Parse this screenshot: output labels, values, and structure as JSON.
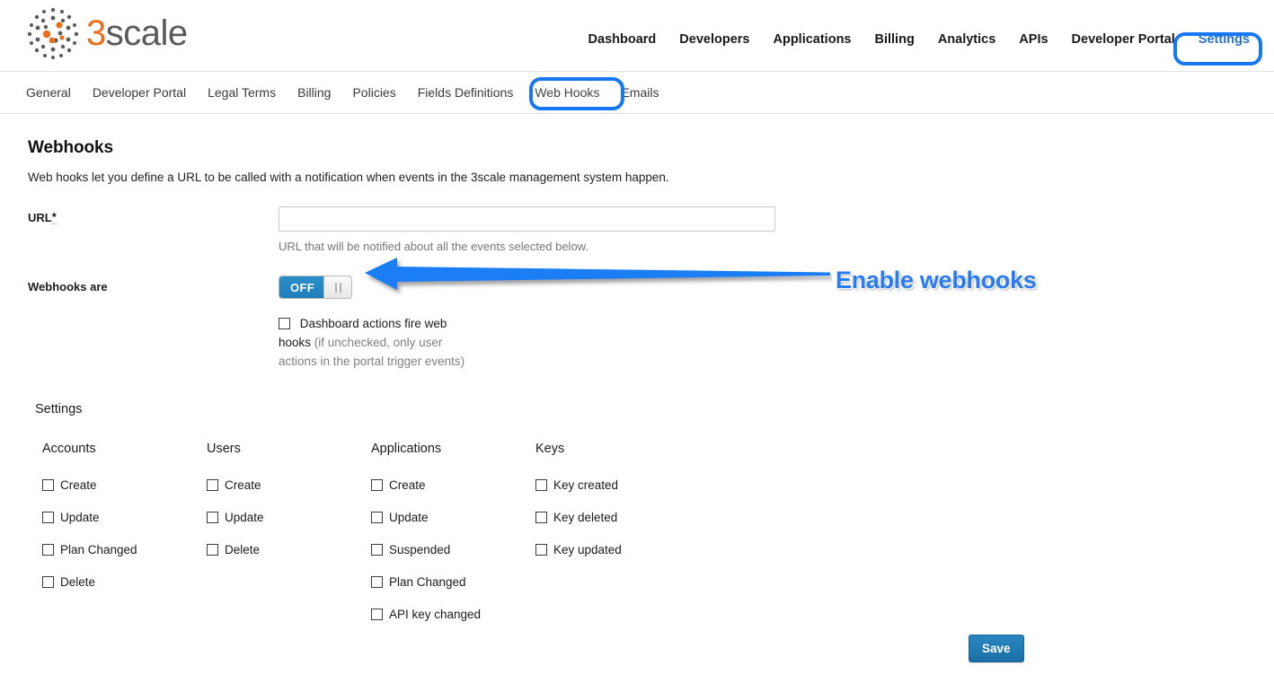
{
  "brand": {
    "logo_icon": "3scale-dots-logo",
    "name_first": "3",
    "name_rest": "scale",
    "orange": "#e8701a",
    "grey": "#58595b"
  },
  "main_nav": {
    "items": [
      {
        "label": "Dashboard",
        "active": false
      },
      {
        "label": "Developers",
        "active": false
      },
      {
        "label": "Applications",
        "active": false
      },
      {
        "label": "Billing",
        "active": false
      },
      {
        "label": "Analytics",
        "active": false
      },
      {
        "label": "APIs",
        "active": false
      },
      {
        "label": "Developer Portal",
        "active": false
      },
      {
        "label": "Settings",
        "active": true
      }
    ]
  },
  "sub_nav": {
    "items": [
      {
        "label": "General",
        "active": false
      },
      {
        "label": "Developer Portal",
        "active": false
      },
      {
        "label": "Legal Terms",
        "active": false
      },
      {
        "label": "Billing",
        "active": false
      },
      {
        "label": "Policies",
        "active": false
      },
      {
        "label": "Fields Definitions",
        "active": false
      },
      {
        "label": "Web Hooks",
        "active": true
      },
      {
        "label": "Emails",
        "active": false
      }
    ]
  },
  "page": {
    "title": "Webhooks",
    "description": "Web hooks let you define a URL to be called with a notification when events in the 3scale management system happen."
  },
  "url_field": {
    "label": "URL",
    "required_marker": "*",
    "value": "",
    "placeholder": "",
    "hint": "URL that will be notified about all the events selected below."
  },
  "toggle": {
    "label": "Webhooks are",
    "state_label": "OFF",
    "checked": false,
    "on_color": "#2380bd"
  },
  "dashboard_checkbox": {
    "label": "Dashboard actions fire web hooks",
    "hint": "(if unchecked, only user actions in the portal trigger events)",
    "checked": false
  },
  "settings_section": {
    "heading": "Settings",
    "groups": [
      {
        "title": "Accounts",
        "items": [
          {
            "label": "Create",
            "checked": false
          },
          {
            "label": "Update",
            "checked": false
          },
          {
            "label": "Plan Changed",
            "checked": false
          },
          {
            "label": "Delete",
            "checked": false
          }
        ]
      },
      {
        "title": "Users",
        "items": [
          {
            "label": "Create",
            "checked": false
          },
          {
            "label": "Update",
            "checked": false
          },
          {
            "label": "Delete",
            "checked": false
          }
        ]
      },
      {
        "title": "Applications",
        "items": [
          {
            "label": "Create",
            "checked": false
          },
          {
            "label": "Update",
            "checked": false
          },
          {
            "label": "Suspended",
            "checked": false
          },
          {
            "label": "Plan Changed",
            "checked": false
          },
          {
            "label": "API key changed",
            "checked": false
          }
        ]
      },
      {
        "title": "Keys",
        "items": [
          {
            "label": "Key created",
            "checked": false
          },
          {
            "label": "Key deleted",
            "checked": false
          },
          {
            "label": "Key updated",
            "checked": false
          }
        ]
      }
    ]
  },
  "save_button": {
    "label": "Save"
  },
  "annotation": {
    "text": "Enable webhooks",
    "color": "#2a7bf2",
    "arrow_direction": "left",
    "highlight_boxes": [
      "Settings",
      "Web Hooks"
    ],
    "highlight_color": "#1877f2"
  }
}
